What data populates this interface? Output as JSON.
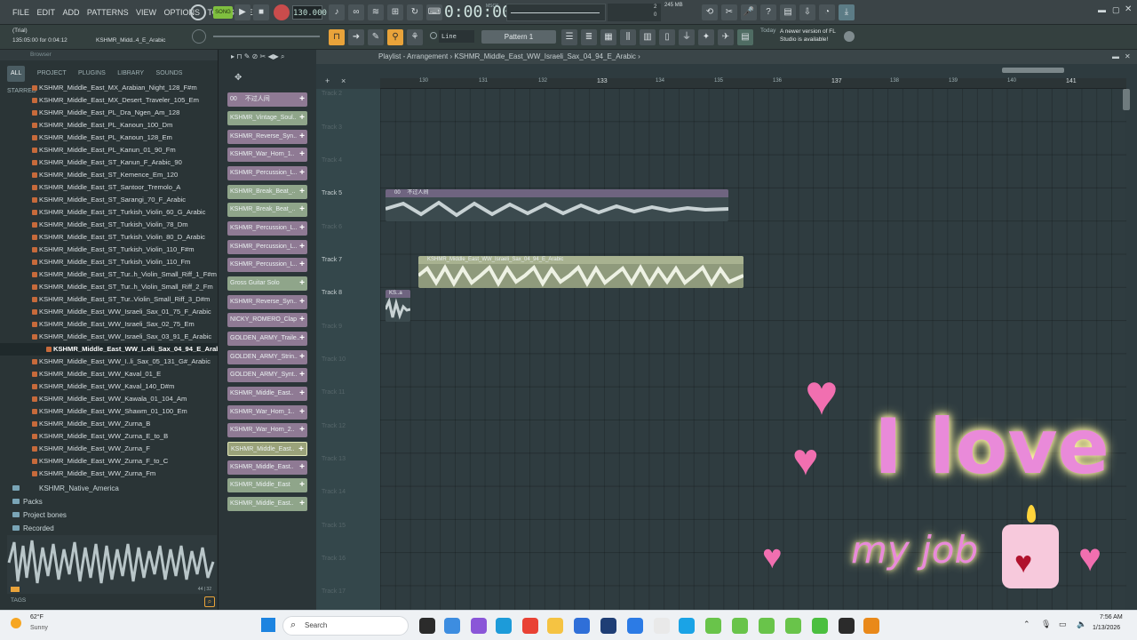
{
  "menu": {
    "items": [
      "FILE",
      "EDIT",
      "ADD",
      "PATTERNS",
      "VIEW",
      "OPTIONS",
      "TOOLS",
      "HELP"
    ]
  },
  "transport": {
    "tempo": "130.000",
    "time": "0:00:00",
    "time_units": "MSCS",
    "memory": "245 MB",
    "pattern": "Pattern 1",
    "snap": "Line",
    "cpu": "2",
    "voices": "0"
  },
  "hint": {
    "status": "(Trial)",
    "position": "135:05:00 for 0:04:12",
    "sample": "KSHMR_Midd..4_E_Arabic"
  },
  "news": {
    "label": "Today",
    "text": "A newer version of FL Studio is available!"
  },
  "browser": {
    "title": "Browser",
    "tabs": [
      "ALL",
      "PROJECT",
      "PLUGINS",
      "LIBRARY",
      "SOUNDS",
      "STARRED"
    ],
    "files": [
      "KSHMR_Middle_East_MX_Arabian_Night_128_F#m",
      "KSHMR_Middle_East_MX_Desert_Traveler_105_Em",
      "KSHMR_Middle_East_PL_Dra_Ngen_Am_128",
      "KSHMR_Middle_East_PL_Kanoun_100_Dm",
      "KSHMR_Middle_East_PL_Kanoun_128_Em",
      "KSHMR_Middle_East_PL_Kanun_01_90_Fm",
      "KSHMR_Middle_East_ST_Kanun_F_Arabic_90",
      "KSHMR_Middle_East_ST_Kemence_Em_120",
      "KSHMR_Middle_East_ST_Santoor_Tremolo_A",
      "KSHMR_Middle_East_ST_Sarangi_70_F_Arabic",
      "KSHMR_Middle_East_ST_Turkish_Violin_60_G_Arabic",
      "KSHMR_Middle_East_ST_Turkish_Violin_78_Dm",
      "KSHMR_Middle_East_ST_Turkish_Violin_80_D_Arabic",
      "KSHMR_Middle_East_ST_Turkish_Violin_110_F#m",
      "KSHMR_Middle_East_ST_Turkish_Violin_110_Fm",
      "KSHMR_Middle_East_ST_Tur..h_Violin_Small_Riff_1_F#m",
      "KSHMR_Middle_East_ST_Tur..h_Violin_Small_Riff_2_Fm",
      "KSHMR_Middle_East_ST_Tur..Violin_Small_Riff_3_D#m",
      "KSHMR_Middle_East_WW_Israeli_Sax_01_75_F_Arabic",
      "KSHMR_Middle_East_WW_Israeli_Sax_02_75_Em",
      "KSHMR_Middle_East_WW_Israeli_Sax_03_91_E_Arabic",
      "KSHMR_Middle_East_WW_I..eli_Sax_04_94_E_Arabic",
      "KSHMR_Middle_East_WW_I..li_Sax_05_131_G#_Arabic",
      "KSHMR_Middle_East_WW_Kaval_01_E",
      "KSHMR_Middle_East_WW_Kaval_140_D#m",
      "KSHMR_Middle_East_WW_Kawala_01_104_Am",
      "KSHMR_Middle_East_WW_Shawm_01_100_Em",
      "KSHMR_Middle_East_WW_Zurna_B",
      "KSHMR_Middle_East_WW_Zurna_E_to_B",
      "KSHMR_Middle_East_WW_Zurna_F",
      "KSHMR_Middle_East_WW_Zurna_F_to_C",
      "KSHMR_Middle_East_WW_Zurna_Fm"
    ],
    "folders": [
      "KSHMR_Native_America",
      "Packs",
      "Project bones",
      "Recorded"
    ],
    "preview_meta": "44 | 32",
    "tags_label": "TAGS"
  },
  "channels": [
    {
      "name": "00 　不过人间",
      "color": "#8f7a94"
    },
    {
      "name": "KSHMR_Vintage_Soul..",
      "color": "#8fa58a"
    },
    {
      "name": "KSHMR_Reverse_Syn..",
      "color": "#8f7a94"
    },
    {
      "name": "KSHMR_War_Horn_1..",
      "color": "#8f7a94"
    },
    {
      "name": "KSHMR_Percussion_L..",
      "color": "#8f7a94"
    },
    {
      "name": "KSHMR_Break_Beat_..",
      "color": "#8fa58a"
    },
    {
      "name": "KSHMR_Break_Beat_..",
      "color": "#8fa58a"
    },
    {
      "name": "KSHMR_Percussion_L..",
      "color": "#8f7a94"
    },
    {
      "name": "KSHMR_Percussion_L..",
      "color": "#8f7a94"
    },
    {
      "name": "KSHMR_Percussion_L..",
      "color": "#8f7a94"
    },
    {
      "name": "Gross Guitar Solo",
      "color": "#8fa58a"
    },
    {
      "name": "KSHMR_Reverse_Syn..",
      "color": "#8f7a94"
    },
    {
      "name": "NICKY_ROMERO_Clap",
      "color": "#8f7a94"
    },
    {
      "name": "GOLDEN_ARMY_Traile..",
      "color": "#8f7a94"
    },
    {
      "name": "GOLDEN_ARMY_Strin..",
      "color": "#8f7a94"
    },
    {
      "name": "GOLDEN_ARMY_Synt..",
      "color": "#8f7a94"
    },
    {
      "name": "KSHMR_Middle_East..",
      "color": "#8f7a94"
    },
    {
      "name": "KSHMR_War_Horn_1..",
      "color": "#8f7a94"
    },
    {
      "name": "KSHMR_War_Horn_2..",
      "color": "#8f7a94"
    },
    {
      "name": "KSHMR_Middle_East..",
      "color": "#9aa27a"
    },
    {
      "name": "KSHMR_Middle_East..",
      "color": "#8f7a94"
    },
    {
      "name": "KSHMR_Middle_East",
      "color": "#8fa58a"
    },
    {
      "name": "KSHMR_Middle_East..",
      "color": "#8fa58a"
    }
  ],
  "playlist": {
    "breadcrumb": "Playlist - Arrangement › KSHMR_Middle_East_WW_Israeli_Sax_04_94_E_Arabic ›",
    "ruler": [
      "130",
      "131",
      "132",
      "133",
      "134",
      "135",
      "136",
      "137",
      "138",
      "139",
      "140",
      "141"
    ],
    "tracks": [
      "Track 2",
      "Track 3",
      "Track 4",
      "Track 5",
      "Track 6",
      "Track 7",
      "Track 8",
      "Track 9",
      "Track 10",
      "Track 11",
      "Track 12",
      "Track 13",
      "Track 14",
      "Track 15",
      "Track 16",
      "Track 17"
    ],
    "clips": [
      {
        "title": "00 　不过人间",
        "track": "Track 5"
      },
      {
        "title": "KSHMR_Middle_East_WW_Israeli_Sax_04_94_E_Arabic",
        "track": "Track 7"
      },
      {
        "title": "KS..a",
        "track": "Track 8"
      }
    ]
  },
  "overlay": {
    "line1": "I love",
    "line2": "my job"
  },
  "taskbar": {
    "temp": "62°F",
    "weather": "Sunny",
    "search": "Search",
    "time": "7:56 AM",
    "date": "1/13/2026"
  },
  "colors": {
    "accent": "#e9a33a",
    "clip_purple": "#8a7a96",
    "clip_green": "#c5d2b3",
    "pink": "#e98ad9"
  }
}
